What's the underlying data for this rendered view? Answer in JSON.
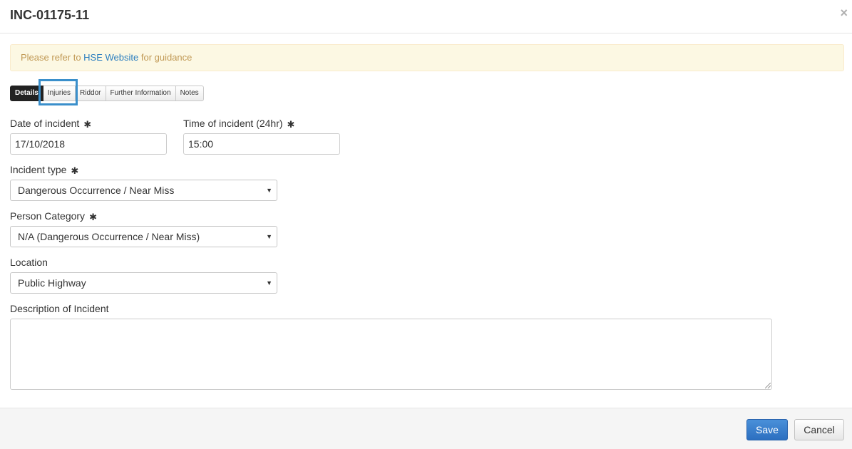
{
  "modal": {
    "title": "INC-01175-11",
    "close_symbol": "×"
  },
  "alert": {
    "prefix": "Please refer to ",
    "link_text": "HSE Website",
    "suffix": " for guidance"
  },
  "tabs": [
    {
      "label": "Details",
      "active": true
    },
    {
      "label": "Injuries",
      "active": false
    },
    {
      "label": "Riddor",
      "active": false
    },
    {
      "label": "Further Information",
      "active": false
    },
    {
      "label": "Notes",
      "active": false
    }
  ],
  "form": {
    "required_symbol": "✱",
    "date_label": "Date of incident",
    "date_value": "17/10/2018",
    "time_label": "Time of incident (24hr)",
    "time_value": "15:00",
    "incident_type_label": "Incident type",
    "incident_type_value": "Dangerous Occurrence / Near Miss",
    "person_category_label": "Person Category",
    "person_category_value": "N/A (Dangerous Occurrence / Near Miss)",
    "location_label": "Location",
    "location_value": "Public Highway",
    "description_label": "Description of Incident",
    "description_value": "",
    "caret_symbol": "▼"
  },
  "footer": {
    "save_label": "Save",
    "cancel_label": "Cancel"
  },
  "colors": {
    "alert_bg": "#fcf8e3",
    "alert_text": "#c09853",
    "link": "#2a7dbf",
    "active_tab": "#222222",
    "highlight": "#3a8fcb",
    "save_button": "#3779c9"
  }
}
